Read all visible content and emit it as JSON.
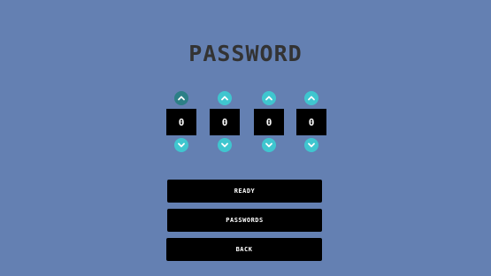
{
  "screen": {
    "title": "PASSWORD"
  },
  "digits": [
    {
      "value": "0",
      "up_icon": "chevron-up-icon",
      "down_icon": "chevron-down-icon"
    },
    {
      "value": "0",
      "up_icon": "chevron-up-icon",
      "down_icon": "chevron-down-icon"
    },
    {
      "value": "0",
      "up_icon": "chevron-up-icon",
      "down_icon": "chevron-down-icon"
    },
    {
      "value": "0",
      "up_icon": "chevron-up-icon",
      "down_icon": "chevron-down-icon"
    }
  ],
  "buttons": {
    "ready": "READY",
    "passwords": "PASSWORDS",
    "back": "BACK"
  },
  "colors": {
    "background": "#6480b2",
    "title": "#333333",
    "arrow": "#3fc6cf",
    "arrow_selected": "#2c7f86",
    "box": "#000000",
    "text": "#ffffff"
  }
}
